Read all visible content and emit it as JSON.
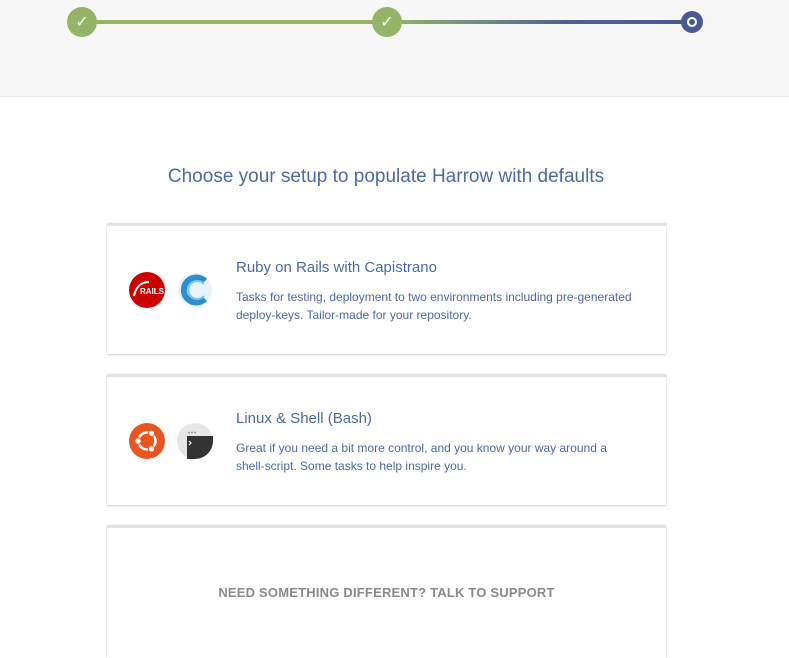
{
  "stepper": {
    "steps": [
      {
        "status": "complete",
        "icon": "check-icon"
      },
      {
        "status": "complete",
        "icon": "check-icon"
      },
      {
        "status": "current",
        "icon": "ring-icon"
      }
    ],
    "colors": {
      "complete": "#95b467",
      "current": "#4a5a90"
    }
  },
  "heading": "Choose your setup to populate Harrow with defaults",
  "setups": [
    {
      "title": "Ruby on Rails with Capistrano",
      "description": "Tasks for testing, deployment to two environments including pre-generated deploy-keys. Tailor-made for your repository.",
      "logos": [
        "rails-logo",
        "capistrano-logo"
      ]
    },
    {
      "title": "Linux & Shell (Bash)",
      "description": "Great if you need a bit more control, and you know your way around a shell-script. Some tasks to help inspire you.",
      "logos": [
        "ubuntu-logo",
        "terminal-logo"
      ]
    }
  ],
  "support": {
    "label": "NEED SOMETHING DIFFERENT? TALK TO SUPPORT"
  },
  "colors": {
    "accent": "#4d6aa0",
    "rails": "#cc0000",
    "capistrano": "#2e8fcf",
    "ubuntu": "#e95420",
    "terminal": "#333333"
  }
}
